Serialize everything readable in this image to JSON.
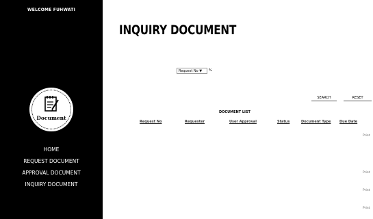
{
  "sidebar": {
    "welcome": "WELCOME FUHWATI",
    "logo_text": "Document",
    "nav": [
      "HOME",
      "REQUEST DOCUMENT",
      "APPROVAL DOCUMENT",
      "INQUIRY DOCUMENT"
    ]
  },
  "main": {
    "title": "INQUIRY DOCUMENT",
    "filter": {
      "selected": "Request No",
      "suffix": "%"
    },
    "buttons": {
      "search": "SEARCH",
      "reset": "RESET"
    },
    "list_title": "DOCUMENT LIST",
    "columns": [
      "Request No",
      "Requester",
      "User Approval",
      "Status",
      "Document Type",
      "Due Date"
    ],
    "rows": [
      {
        "action": "Print"
      },
      {
        "action": "Print"
      },
      {
        "action": "Print"
      },
      {
        "action": "Print"
      }
    ]
  }
}
